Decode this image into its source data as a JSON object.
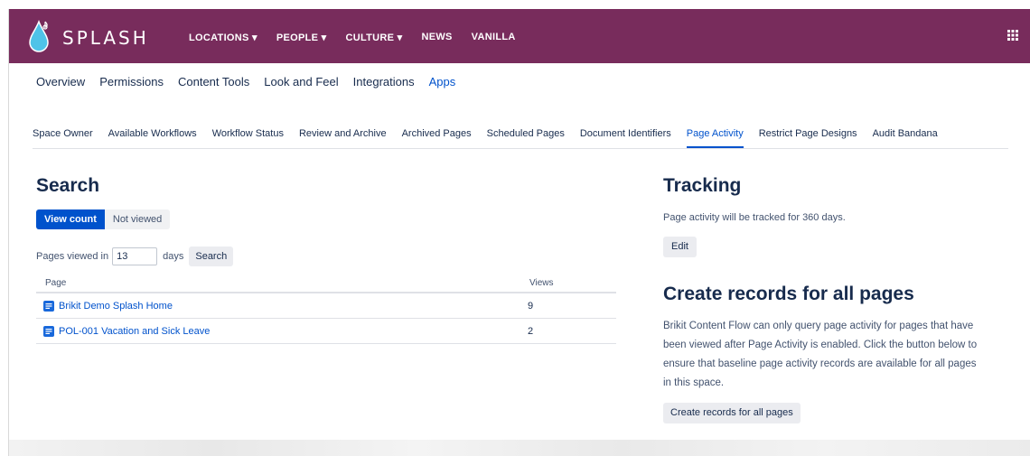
{
  "header": {
    "logo_text": "SPLASH",
    "nav": [
      "LOCATIONS ▾",
      "PEOPLE ▾",
      "CULTURE ▾",
      "NEWS",
      "VANILLA"
    ],
    "bg_color": "#782c5c",
    "apps_icon": "grid-icon"
  },
  "primary_tabs": [
    "Overview",
    "Permissions",
    "Content Tools",
    "Look and Feel",
    "Integrations",
    "Apps"
  ],
  "primary_active": "Apps",
  "secondary_tabs": [
    "Space Owner",
    "Available Workflows",
    "Workflow Status",
    "Review and Archive",
    "Archived Pages",
    "Scheduled Pages",
    "Document Identifiers",
    "Page Activity",
    "Restrict Page Designs",
    "Audit Bandana"
  ],
  "secondary_active": "Page Activity",
  "search": {
    "title": "Search",
    "toggle_view_count": "View count",
    "toggle_not_viewed": "Not viewed",
    "pages_viewed_label": "Pages viewed in",
    "days_value": "13",
    "days_label": "days",
    "search_button": "Search",
    "table": {
      "headers": [
        "Page",
        "Views"
      ],
      "rows": [
        {
          "page": "Brikit Demo Splash Home",
          "views": "9"
        },
        {
          "page": "POL-001 Vacation and Sick Leave",
          "views": "2"
        }
      ]
    }
  },
  "tracking": {
    "title": "Tracking",
    "text": "Page activity will be tracked for 360 days.",
    "edit_button": "Edit"
  },
  "create": {
    "title": "Create records for all pages",
    "text": "Brikit Content Flow can only query page activity for pages that have been viewed after Page Activity is enabled. Click the button below to ensure that baseline page activity records are available for all pages in this space.",
    "button": "Create records for all pages"
  },
  "colors": {
    "accent": "#0052cc",
    "text": "#172b4d"
  }
}
